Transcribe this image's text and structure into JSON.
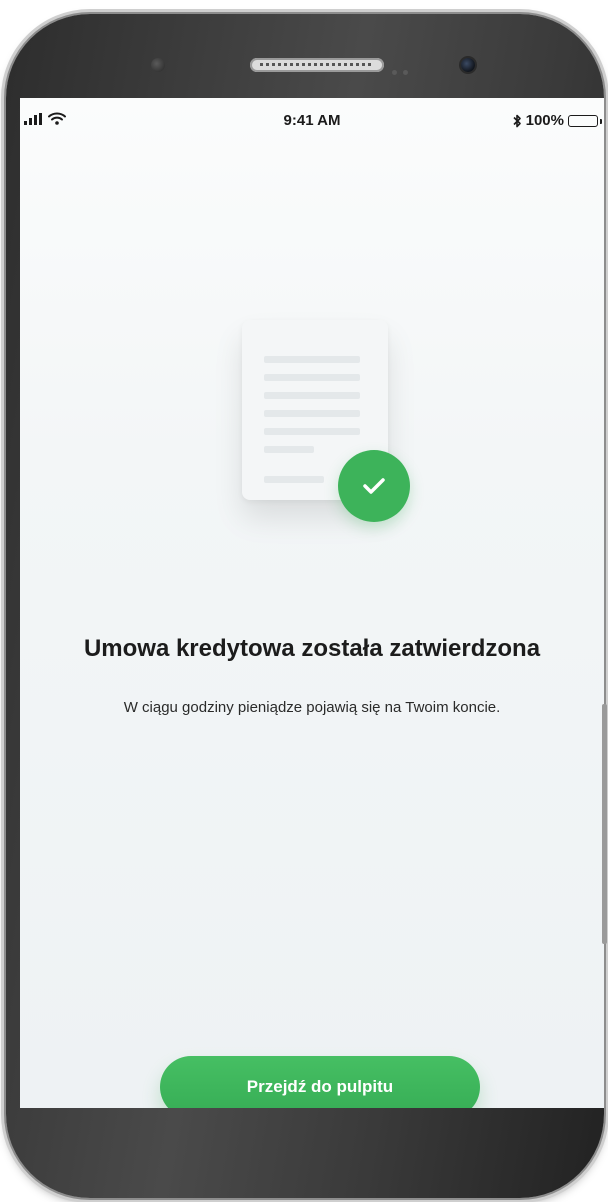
{
  "status_bar": {
    "time": "9:41 AM",
    "battery_text": "100%",
    "battery_level": 1.0,
    "icons": [
      "signal-icon",
      "wifi-icon",
      "bluetooth-icon",
      "battery-icon"
    ]
  },
  "confirmation": {
    "title": "Umowa kredytowa została zatwierdzona",
    "message": "W ciągu godziny pieniądze pojawią się na Twoim koncie.",
    "illustration_icons": [
      "document-icon",
      "check-circle-icon"
    ]
  },
  "actions": {
    "primary_label": "Przejdź do pulpitu"
  },
  "colors": {
    "accent_green": "#3db35a",
    "background": "#f3f6f7",
    "text": "#1c1c1c"
  }
}
